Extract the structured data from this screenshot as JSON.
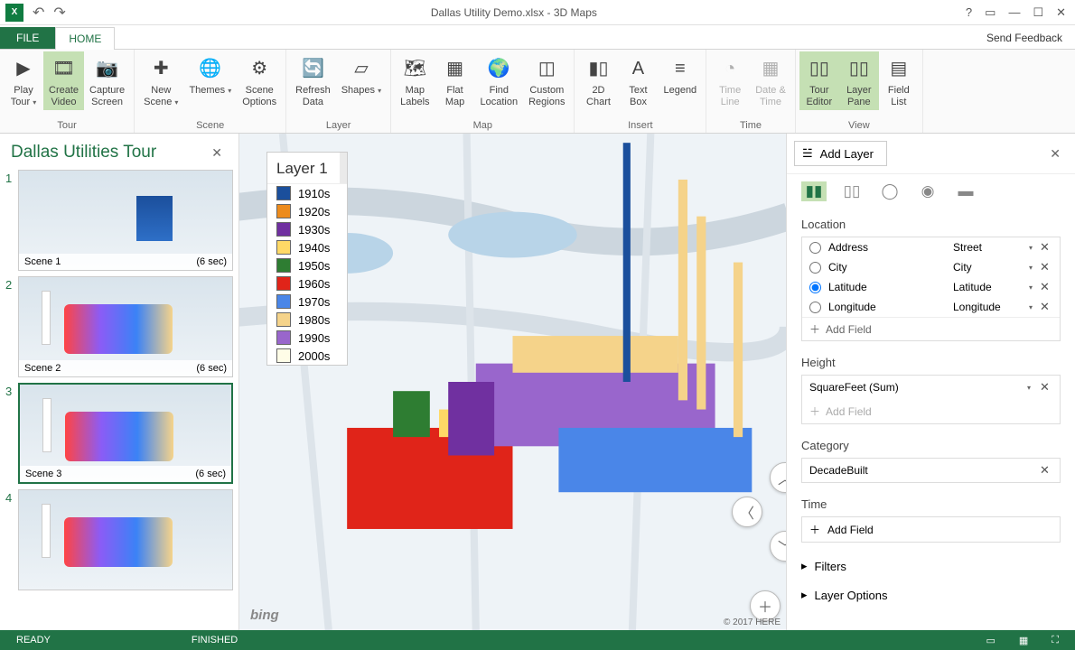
{
  "title": "Dallas Utility Demo.xlsx - 3D Maps",
  "window": {
    "help": "?",
    "send_feedback": "Send Feedback"
  },
  "tabs": {
    "file": "FILE",
    "home": "HOME"
  },
  "ribbon": {
    "groups": [
      {
        "label": "Tour",
        "buttons": [
          {
            "id": "play-tour",
            "label": "Play\nTour",
            "caret": true
          },
          {
            "id": "create-video",
            "label": "Create\nVideo",
            "hl": true
          },
          {
            "id": "capture-screen",
            "label": "Capture\nScreen"
          }
        ]
      },
      {
        "label": "Scene",
        "buttons": [
          {
            "id": "new-scene",
            "label": "New\nScene",
            "caret": true
          },
          {
            "id": "themes",
            "label": "Themes",
            "caret": true
          },
          {
            "id": "scene-options",
            "label": "Scene\nOptions"
          }
        ]
      },
      {
        "label": "Layer",
        "buttons": [
          {
            "id": "refresh-data",
            "label": "Refresh\nData"
          },
          {
            "id": "shapes",
            "label": "Shapes",
            "caret": true
          }
        ]
      },
      {
        "label": "Map",
        "buttons": [
          {
            "id": "map-labels",
            "label": "Map\nLabels"
          },
          {
            "id": "flat-map",
            "label": "Flat\nMap"
          },
          {
            "id": "find-location",
            "label": "Find\nLocation"
          },
          {
            "id": "custom-regions",
            "label": "Custom\nRegions"
          }
        ]
      },
      {
        "label": "Insert",
        "buttons": [
          {
            "id": "2d-chart",
            "label": "2D\nChart"
          },
          {
            "id": "text-box",
            "label": "Text\nBox"
          },
          {
            "id": "legend",
            "label": "Legend"
          }
        ]
      },
      {
        "label": "Time",
        "buttons": [
          {
            "id": "time-line",
            "label": "Time\nLine",
            "disabled": true
          },
          {
            "id": "date-time",
            "label": "Date &\nTime",
            "disabled": true
          }
        ]
      },
      {
        "label": "View",
        "buttons": [
          {
            "id": "tour-editor",
            "label": "Tour\nEditor",
            "hl": true
          },
          {
            "id": "layer-pane",
            "label": "Layer\nPane",
            "hl": true
          },
          {
            "id": "field-list",
            "label": "Field\nList"
          }
        ]
      }
    ]
  },
  "tour": {
    "title": "Dallas Utilities Tour",
    "scenes": [
      {
        "num": "1",
        "name": "Scene 1",
        "dur": "(6 sec)",
        "thumb": "t1"
      },
      {
        "num": "2",
        "name": "Scene 2",
        "dur": "(6 sec)",
        "thumb": "t2"
      },
      {
        "num": "3",
        "name": "Scene 3",
        "dur": "(6 sec)",
        "selected": true,
        "thumb": "t2"
      },
      {
        "num": "4",
        "name": "",
        "dur": "",
        "thumb": "t2"
      }
    ]
  },
  "legend": {
    "title": "Layer 1",
    "items": [
      {
        "c": "#1b4f9c",
        "l": "1910s"
      },
      {
        "c": "#ed8b1c",
        "l": "1920s"
      },
      {
        "c": "#7030a0",
        "l": "1930s"
      },
      {
        "c": "#ffd966",
        "l": "1940s"
      },
      {
        "c": "#2e7d32",
        "l": "1950s"
      },
      {
        "c": "#e02419",
        "l": "1960s"
      },
      {
        "c": "#4a86e8",
        "l": "1970s"
      },
      {
        "c": "#f5d38a",
        "l": "1980s"
      },
      {
        "c": "#9966cc",
        "l": "1990s"
      },
      {
        "c": "#fffde7",
        "l": "2000s"
      }
    ]
  },
  "map": {
    "attribution": "bing",
    "copyright": "© 2017 HERE"
  },
  "layer_pane": {
    "add_layer": "Add Layer",
    "location_label": "Location",
    "location_fields": [
      {
        "selected": false,
        "name": "Address",
        "type": "Street"
      },
      {
        "selected": false,
        "name": "City",
        "type": "City"
      },
      {
        "selected": true,
        "name": "Latitude",
        "type": "Latitude"
      },
      {
        "selected": false,
        "name": "Longitude",
        "type": "Longitude"
      }
    ],
    "add_field": "Add Field",
    "height_label": "Height",
    "height_value": "SquareFeet (Sum)",
    "category_label": "Category",
    "category_value": "DecadeBuilt",
    "time_label": "Time",
    "filters": "Filters",
    "layer_options": "Layer Options"
  },
  "status": {
    "ready": "READY",
    "finished": "FINISHED"
  }
}
